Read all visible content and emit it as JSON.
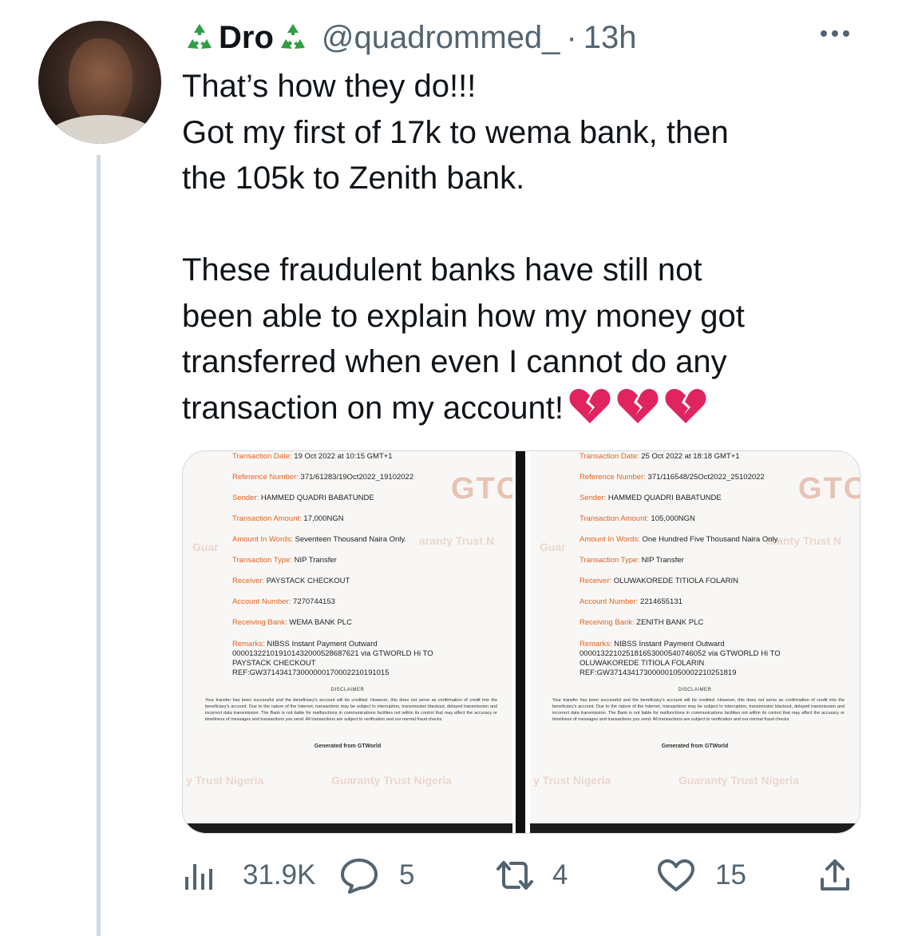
{
  "tweet": {
    "display_name": "Dro",
    "handle": "@quadrommed_",
    "separator": "·",
    "time": "13h",
    "text_lines_1": [
      "That’s how they do!!!",
      "Got my first of 17k to wema bank, then",
      "the 105k  to Zenith bank."
    ],
    "text_lines_2": [
      "These fraudulent banks have still not",
      "been able to explain how my money got",
      "transferred when even I cannot do any"
    ],
    "text_last": "transaction on my account!"
  },
  "receipts": [
    {
      "date_label": "Transaction Date:",
      "date": "19 Oct 2022 at 10:15 GMT+1",
      "ref_label": "Reference Number:",
      "ref": "371/61283/19Oct2022_19102022",
      "sender_label": "Sender:",
      "sender": "HAMMED QUADRI BABATUNDE",
      "amount_label": "Transaction Amount:",
      "amount": "17,000NGN",
      "words_label": "Amount In Words:",
      "words": "Seventeen Thousand Naira Only.",
      "type_label": "Transaction Type:",
      "type": "NIP Transfer",
      "receiver_label": "Receiver:",
      "receiver": "PAYSTACK CHECKOUT",
      "acct_label": "Account Number:",
      "acct": "7270744153",
      "bank_label": "Receiving Bank:",
      "bank": "WEMA BANK PLC",
      "remarks_label": "Remarks:",
      "remarks_1": "NIBSS Instant Payment Outward",
      "remarks_2": "000013221019101432000528687621 via GTWORLD Hi TO",
      "remarks_3": "PAYSTACK CHECKOUT",
      "remarks_4": "REF:GW3714341730000001700022101910​15",
      "disclaimer_title": "DISCLAIMER",
      "disclaimer": "Your transfer has been successful and the beneficiary's account will be credited. However, this does not serve as confirmation of credit into the beneficiary's account. Due to the nature of the Internet, transactions may be subject to interruption, transmission blackout, delayed transmission and incorrect data transmission. The Bank is not liable for malfunctions in communications facilities not within its control that may affect the accuracy or timeliness of messages and transactions you send. All transactions are subject to verification and our normal fraud checks",
      "generated": "Generated from GTWorld"
    },
    {
      "date_label": "Transaction Date:",
      "date": "25 Oct 2022 at 18:18 GMT+1",
      "ref_label": "Reference Number:",
      "ref": "371/116548/25Oct2022_25102022",
      "sender_label": "Sender:",
      "sender": "HAMMED QUADRI BABATUNDE",
      "amount_label": "Transaction Amount:",
      "amount": "105,000NGN",
      "words_label": "Amount In Words:",
      "words": "One Hundred Five Thousand Naira Only.",
      "type_label": "Transaction Type:",
      "type": "NIP Transfer",
      "receiver_label": "Receiver:",
      "receiver": "OLUWAKOREDE TITIOLA FOLARIN",
      "acct_label": "Account Number:",
      "acct": "2214655131",
      "bank_label": "Receiving Bank:",
      "bank": "ZENITH BANK PLC",
      "remarks_label": "Remarks:",
      "remarks_1": "NIBSS Instant Payment Outward",
      "remarks_2": "000013221025181653000540746052 via GTWORLD Hi TO",
      "remarks_3": "OLUWAKOREDE TITIOLA FOLARIN",
      "remarks_4": "REF:GW37143417300000105000221025181​9",
      "disclaimer_title": "DISCLAIMER",
      "disclaimer": "Your transfer has been successful and the beneficiary's account will be credited. However, this does not serve as confirmation of credit into the beneficiary's account. Due to the nature of the Internet, transactions may be subject to interruption, transmission blackout, delayed transmission and incorrect data transmission. The Bank is not liable for malfunctions in communications facilities not within its control that may affect the accuracy or timeliness of messages and transactions you send. All transactions are subject to verification and our normal fraud checks",
      "generated": "Generated from GTWorld"
    }
  ],
  "watermark": {
    "brand": "GTC",
    "left_text": "Guar",
    "mid_text": "aranty Trust N",
    "bottom_1": "y Trust Nigeria",
    "bottom_2": "Guaranty Trust Nigeria"
  },
  "actions": {
    "views": "31.9K",
    "replies": "5",
    "retweets": "4",
    "likes": "15"
  },
  "colors": {
    "text": "#0f1419",
    "secondary": "#536471",
    "recycle_green": "#2f9e44",
    "heart_red": "#e0245e",
    "receipt_label": "#e2621f"
  },
  "icons": [
    "recycle-icon",
    "more-icon",
    "broken-heart-icon",
    "views-icon",
    "reply-icon",
    "retweet-icon",
    "like-icon",
    "share-icon"
  ]
}
